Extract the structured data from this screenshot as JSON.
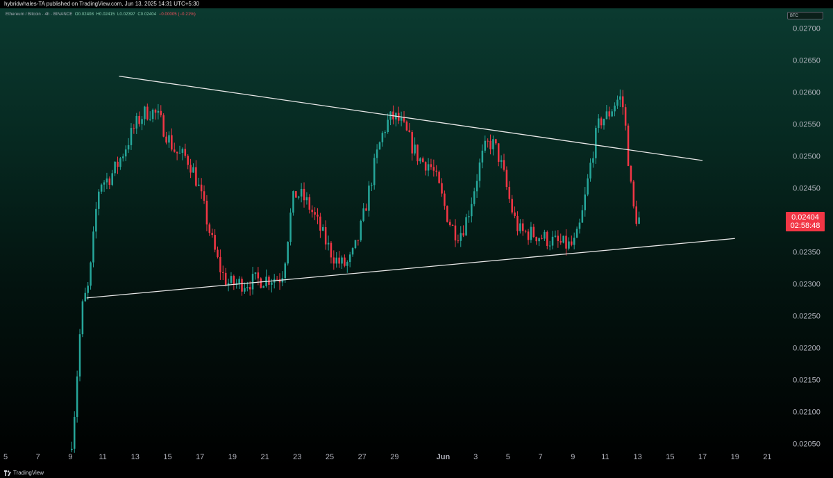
{
  "header": {
    "text": "hybridwhales-TA published on TradingView.com, Jun 13, 2025 14:31 UTC+5:30"
  },
  "legend": {
    "symbol": "Ethereum / Bitcoin · 4h · BINANCE",
    "open": "O0.02408",
    "high": "H0.02415",
    "low": "L0.02397",
    "close": "C0.02404",
    "change": "−0.00005 (−0.21%)"
  },
  "currency_badge": "BTC",
  "last_price": {
    "price": "0.02404",
    "countdown": "02:58:48"
  },
  "footer": {
    "brand": "TradingView"
  },
  "colors": {
    "up": "#26a69a",
    "down": "#f23645",
    "trendline": "#e8e8e8"
  },
  "chart_data": {
    "type": "candlestick",
    "timeframe": "4h",
    "ylim": [
      0.0203,
      0.0273
    ],
    "y_ticks": [
      "0.02050",
      "0.02100",
      "0.02150",
      "0.02200",
      "0.02250",
      "0.02300",
      "0.02350",
      "0.02400",
      "0.02450",
      "0.02500",
      "0.02550",
      "0.02600",
      "0.02650",
      "0.02700"
    ],
    "x_ticks": [
      "5",
      "7",
      "9",
      "11",
      "13",
      "15",
      "17",
      "19",
      "21",
      "23",
      "25",
      "27",
      "29",
      "Jun",
      "3",
      "5",
      "7",
      "9",
      "11",
      "13",
      "15",
      "17",
      "19",
      "21"
    ],
    "x_tick_dates": [
      "2025-05-05",
      "2025-05-07",
      "2025-05-09",
      "2025-05-11",
      "2025-05-13",
      "2025-05-15",
      "2025-05-17",
      "2025-05-19",
      "2025-05-21",
      "2025-05-23",
      "2025-05-25",
      "2025-05-27",
      "2025-05-29",
      "2025-06-01",
      "2025-06-03",
      "2025-06-05",
      "2025-06-07",
      "2025-06-09",
      "2025-06-11",
      "2025-06-13",
      "2025-06-15",
      "2025-06-17",
      "2025-06-19",
      "2025-06-21"
    ],
    "key_prices": [
      {
        "date": "2025-05-09",
        "price": 0.0204
      },
      {
        "date": "2025-05-10",
        "price": 0.0228
      },
      {
        "date": "2025-05-11",
        "price": 0.0246
      },
      {
        "date": "2025-05-14",
        "price": 0.0257
      },
      {
        "date": "2025-05-16",
        "price": 0.025
      },
      {
        "date": "2025-05-19",
        "price": 0.023
      },
      {
        "date": "2025-05-22",
        "price": 0.0231
      },
      {
        "date": "2025-05-23",
        "price": 0.0244
      },
      {
        "date": "2025-05-26",
        "price": 0.0233
      },
      {
        "date": "2025-05-29",
        "price": 0.0256
      },
      {
        "date": "2025-05-31",
        "price": 0.0249
      },
      {
        "date": "2025-06-02",
        "price": 0.0238
      },
      {
        "date": "2025-06-04",
        "price": 0.0252
      },
      {
        "date": "2025-06-06",
        "price": 0.0238
      },
      {
        "date": "2025-06-09",
        "price": 0.0236
      },
      {
        "date": "2025-06-11",
        "price": 0.0256
      },
      {
        "date": "2025-06-12",
        "price": 0.0259
      },
      {
        "date": "2025-06-13",
        "price": 0.02404
      }
    ],
    "trendlines": [
      {
        "name": "upper",
        "from": {
          "date": "2025-05-12",
          "price": 0.02625
        },
        "to": {
          "date": "2025-06-17",
          "price": 0.02493
        }
      },
      {
        "name": "lower",
        "from": {
          "date": "2025-05-10",
          "price": 0.02278
        },
        "to": {
          "date": "2025-06-19",
          "price": 0.02371
        }
      }
    ]
  }
}
